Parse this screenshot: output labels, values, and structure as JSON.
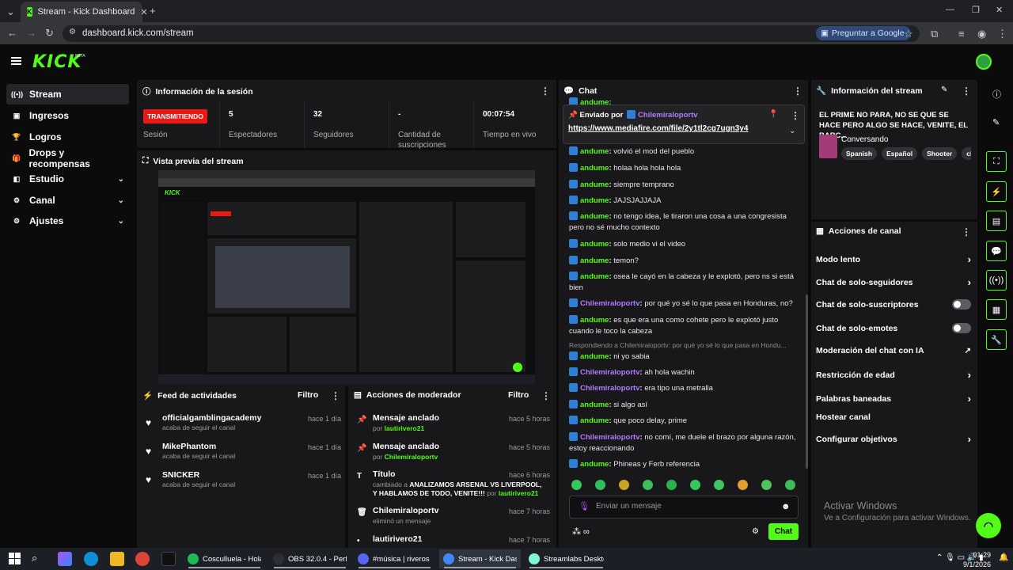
{
  "browser": {
    "tab_title": "Stream - Kick Dashboard",
    "url": "dashboard.kick.com/stream",
    "ask_google": "Preguntar a Google"
  },
  "app": {
    "logo": "KICK",
    "logo_badge": "BETA"
  },
  "nav": [
    {
      "label": "Stream",
      "icon": "stream-icon"
    },
    {
      "label": "Ingresos",
      "icon": "money-icon"
    },
    {
      "label": "Logros",
      "icon": "trophy-icon"
    },
    {
      "label": "Drops y recompensas",
      "icon": "gift-icon"
    },
    {
      "label": "Estudio",
      "icon": "studio-icon"
    },
    {
      "label": "Canal",
      "icon": "channel-icon"
    },
    {
      "label": "Ajustes",
      "icon": "gear-icon"
    }
  ],
  "session": {
    "title": "Información de la sesión",
    "live_badge": "TRANSMITIENDO",
    "session_label": "Sesión",
    "stats": [
      {
        "value": "5",
        "label": "Espectadores"
      },
      {
        "value": "32",
        "label": "Seguidores"
      },
      {
        "value": "-",
        "label": "Cantidad de suscripciones"
      },
      {
        "value": "00:07:54",
        "label": "Tiempo en vivo"
      }
    ]
  },
  "preview": {
    "title": "Vista previa del stream"
  },
  "activity": {
    "title": "Feed de actividades",
    "filter": "Filtro",
    "items": [
      {
        "name": "officialgamblingacademy",
        "sub": "acaba de seguir el canal",
        "time": "hace 1 día"
      },
      {
        "name": "MikePhantom",
        "sub": "acaba de seguir el canal",
        "time": "hace 1 día"
      },
      {
        "name": "SNICKER",
        "sub": "acaba de seguir el canal",
        "time": "hace 1 día"
      }
    ]
  },
  "modactions": {
    "title": "Acciones de moderador",
    "filter": "Filtro",
    "items": [
      {
        "title": "Mensaje anclado",
        "pre": "por ",
        "user": "lautirivero21",
        "time": "hace 5 horas"
      },
      {
        "title": "Mensaje anclado",
        "pre": "por ",
        "user": "Chilemiraloportv",
        "time": "hace 5 horas"
      },
      {
        "title": "Título",
        "pre": "cambiado a ",
        "bold": "ANALIZAMOS ARSENAL VS LIVERPOOL, Y HABLAMOS DE TODO, VENITE!!!",
        "post": " por ",
        "user": "lautirivero21",
        "time": "hace 6 horas"
      },
      {
        "title": "Chilemiraloportv",
        "pre": "eliminó un mensaje",
        "user": "",
        "time": "hace 7 horas"
      },
      {
        "title": "lautirivero21",
        "pre": "",
        "user": "",
        "time": "hace 7 horas"
      }
    ]
  },
  "chat": {
    "title": "Chat",
    "pinned_label": "Enviado por",
    "pinned_user": "Chilemiraloportv",
    "pinned_link": "https://www.mediafire.com/file/2y1tl2cg7ugn3y4",
    "top_user": "andume:",
    "messages": [
      {
        "user": "andume",
        "text": "volvió el mod del pueblo"
      },
      {
        "user": "andume",
        "text": "holaa hola hola hola"
      },
      {
        "user": "andume",
        "text": "siempre temprano"
      },
      {
        "user": "andume",
        "text": "JAJSJAJJAJA"
      },
      {
        "user": "andume",
        "text": "no tengo idea, le tiraron una cosa a una congresista pero no sé mucho contexto"
      },
      {
        "user": "andume",
        "text": "solo medio vi el video"
      },
      {
        "user": "andume",
        "text": "temon?"
      },
      {
        "user": "andume",
        "text": "osea le cayó en la cabeza y le explotó, pero ns si está bien"
      },
      {
        "user": "Chilemiraloportv",
        "text": "por qué yo sé lo que pasa en Honduras, no?"
      },
      {
        "user": "andume",
        "text": "es que era una como cohete pero le explotó justo cuando le toco la cabeza"
      },
      {
        "reply": "Respondiendo a Chilemiraloportv: por qué yo sé lo que pasa en Hondu...",
        "user": "andume",
        "text": "ni yo sabia"
      },
      {
        "user": "Chilemiraloportv",
        "text": "ah hola wachin"
      },
      {
        "user": "Chilemiraloportv",
        "text": "era tipo una metralla"
      },
      {
        "user": "andume",
        "text": "si algo así"
      },
      {
        "user": "andume",
        "text": "que poco delay, prime"
      },
      {
        "user": "Chilemiraloportv",
        "text": "no comí, me duele el brazo por alguna razón, estoy reaccionando"
      },
      {
        "user": "andume",
        "text": "Phineas y Ferb referencia"
      }
    ],
    "input_placeholder": "Enviar un mensaje",
    "send": "Chat"
  },
  "info": {
    "title": "Información del stream",
    "stream_title": "EL PRIME NO PARA, NO SE QUE SE HACE PERO ALGO SE HACE, VENITE, EL BARC...",
    "category": "Conversando",
    "tags": [
      "Spanish",
      "Español",
      "Shooter",
      "chill"
    ]
  },
  "actions": {
    "title": "Acciones de canal",
    "items": [
      {
        "label": "Modo lento",
        "control": "chevron"
      },
      {
        "label": "Chat de solo-seguidores",
        "control": "chevron"
      },
      {
        "label": "Chat de solo-suscriptores",
        "control": "toggle"
      },
      {
        "label": "Chat de solo-emotes",
        "control": "toggle"
      },
      {
        "label": "Moderación del chat con IA",
        "control": "external"
      },
      {
        "label": "Restricción de edad",
        "control": "chevron"
      },
      {
        "label": "Palabras baneadas",
        "control": "chevron"
      },
      {
        "label": "Hostear canal",
        "control": "none"
      },
      {
        "label": "Configurar objetivos",
        "control": "chevron"
      }
    ]
  },
  "watermark": {
    "line1": "Activar Windows",
    "line2": "Ve a Configuración para activar Windows."
  },
  "taskbar": {
    "apps": [
      {
        "label": "Cosculluela - Hola ...",
        "color": "#1db954"
      },
      {
        "label": "OBS 32.0.4 - Perfil: ...",
        "color": "#302e31"
      },
      {
        "label": "#música | riveros - ...",
        "color": "#5865f2"
      },
      {
        "label": "Stream - Kick Dash...",
        "color": "#4285f4"
      },
      {
        "label": "Streamlabs Desktop",
        "color": "#80f5d2"
      }
    ],
    "time": "01:29",
    "date": "9/1/2026"
  },
  "colors": {
    "accent": "#53fc18",
    "live": "#e91916",
    "panel": "#18181b",
    "purple": "#b27cff"
  }
}
